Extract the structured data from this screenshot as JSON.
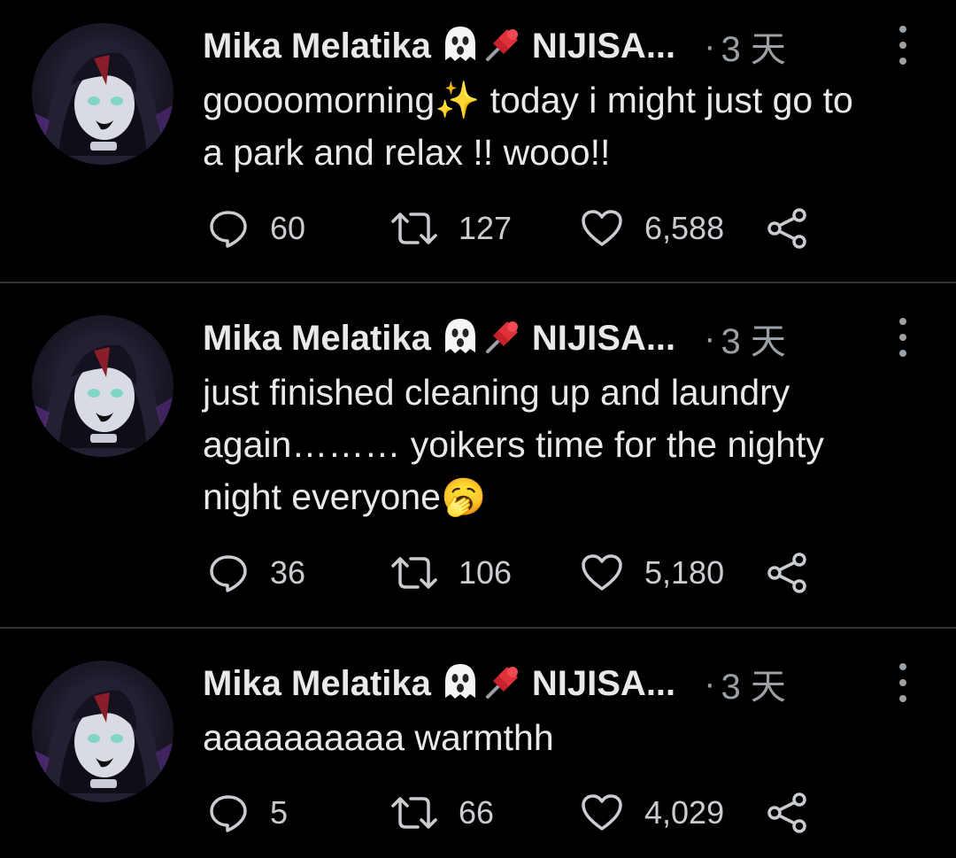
{
  "tweets": [
    {
      "author": "Mika Melatika",
      "handle": "NIJISA...",
      "separator": "·",
      "time": "3 天",
      "text": "goooomorning✨ today i might just go to a park and relax !! wooo!!",
      "text_lines": [
        "goooomorning✨ today i might just go to",
        "a park and relax !! wooo!!"
      ],
      "replies": "60",
      "retweets": "127",
      "likes": "6,588"
    },
    {
      "author": "Mika Melatika",
      "handle": "NIJISA...",
      "separator": "·",
      "time": "3 天",
      "text": "just finished cleaning up and laundry again……… yoikers time for the nighty night everyone🥱",
      "text_lines": [
        "just finished cleaning up and laundry",
        "again……… yoikers time for the nighty",
        "night everyone🥱"
      ],
      "replies": "36",
      "retweets": "106",
      "likes": "5,180"
    },
    {
      "author": "Mika Melatika",
      "handle": "NIJISA...",
      "separator": "·",
      "time": "3 天",
      "text": "aaaaaaaaaa warmthh",
      "text_lines": [
        "aaaaaaaaaa warmthh"
      ],
      "replies": "5",
      "retweets": "66",
      "likes": "4,029"
    }
  ],
  "icons": {
    "ghost": "ghost-emoji",
    "pin": "pushpin-emoji",
    "reply": "reply-icon",
    "retweet": "retweet-icon",
    "like": "heart-icon",
    "share": "share-icon",
    "more": "more-vertical-icon"
  },
  "colors": {
    "background": "#000000",
    "text": "#e7e9ea",
    "muted": "#9aa0a6",
    "divider": "#2f3336",
    "pin_red": "#e0303a",
    "emoji_yellow": "#ffc83d"
  }
}
